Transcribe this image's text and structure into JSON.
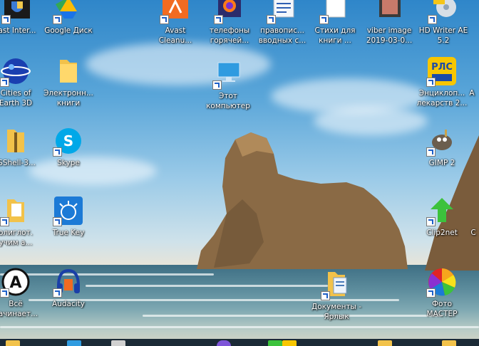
{
  "desktop": {
    "icons": [
      {
        "id": "avast-internet",
        "label": "ast Inter..."
      },
      {
        "id": "google-disk",
        "label": "Google Диск"
      },
      {
        "id": "avast-cleanup",
        "label": "Avast\nCleanu..."
      },
      {
        "id": "telefony",
        "label": "телефоны\nгорячей..."
      },
      {
        "id": "pravopis",
        "label": "правопис...\nвводных с..."
      },
      {
        "id": "stihi",
        "label": "Стихи для\nкниги ..."
      },
      {
        "id": "viber-image",
        "label": "viber image\n2019-03-0..."
      },
      {
        "id": "hd-writer",
        "label": "HD Writer AE\n5.2"
      },
      {
        "id": "cities-of-earth",
        "label": "Cities of\nEarth 3D"
      },
      {
        "id": "electronic-books",
        "label": "Электронн...\nкниги"
      },
      {
        "id": "this-computer",
        "label": "Этот\nкомпьютер"
      },
      {
        "id": "rls",
        "label": "Энциклоп...\nлекарств 2..."
      },
      {
        "id": "rls-right",
        "label": "A"
      },
      {
        "id": "isshell",
        "label": "ISShell-3..."
      },
      {
        "id": "skype",
        "label": "Skype"
      },
      {
        "id": "gimp",
        "label": "GIMP 2"
      },
      {
        "id": "polyglot",
        "label": "олиглот.\nучим а..."
      },
      {
        "id": "true-key",
        "label": "True Key"
      },
      {
        "id": "clip2net",
        "label": "Clip2net"
      },
      {
        "id": "clip2net-right",
        "label": "C"
      },
      {
        "id": "vse-nachinaet",
        "label": "Всё\nначинает..."
      },
      {
        "id": "audacity",
        "label": "Audacity"
      },
      {
        "id": "documents",
        "label": "Документы -\nЯрлык"
      },
      {
        "id": "foto-master",
        "label": "Фото\nМАСТЕР"
      }
    ]
  },
  "colors": {
    "sky_top": "#2f86c9",
    "sea": "#5c8c9c",
    "rock": "#8a6a45",
    "label_text": "#ffffff"
  }
}
